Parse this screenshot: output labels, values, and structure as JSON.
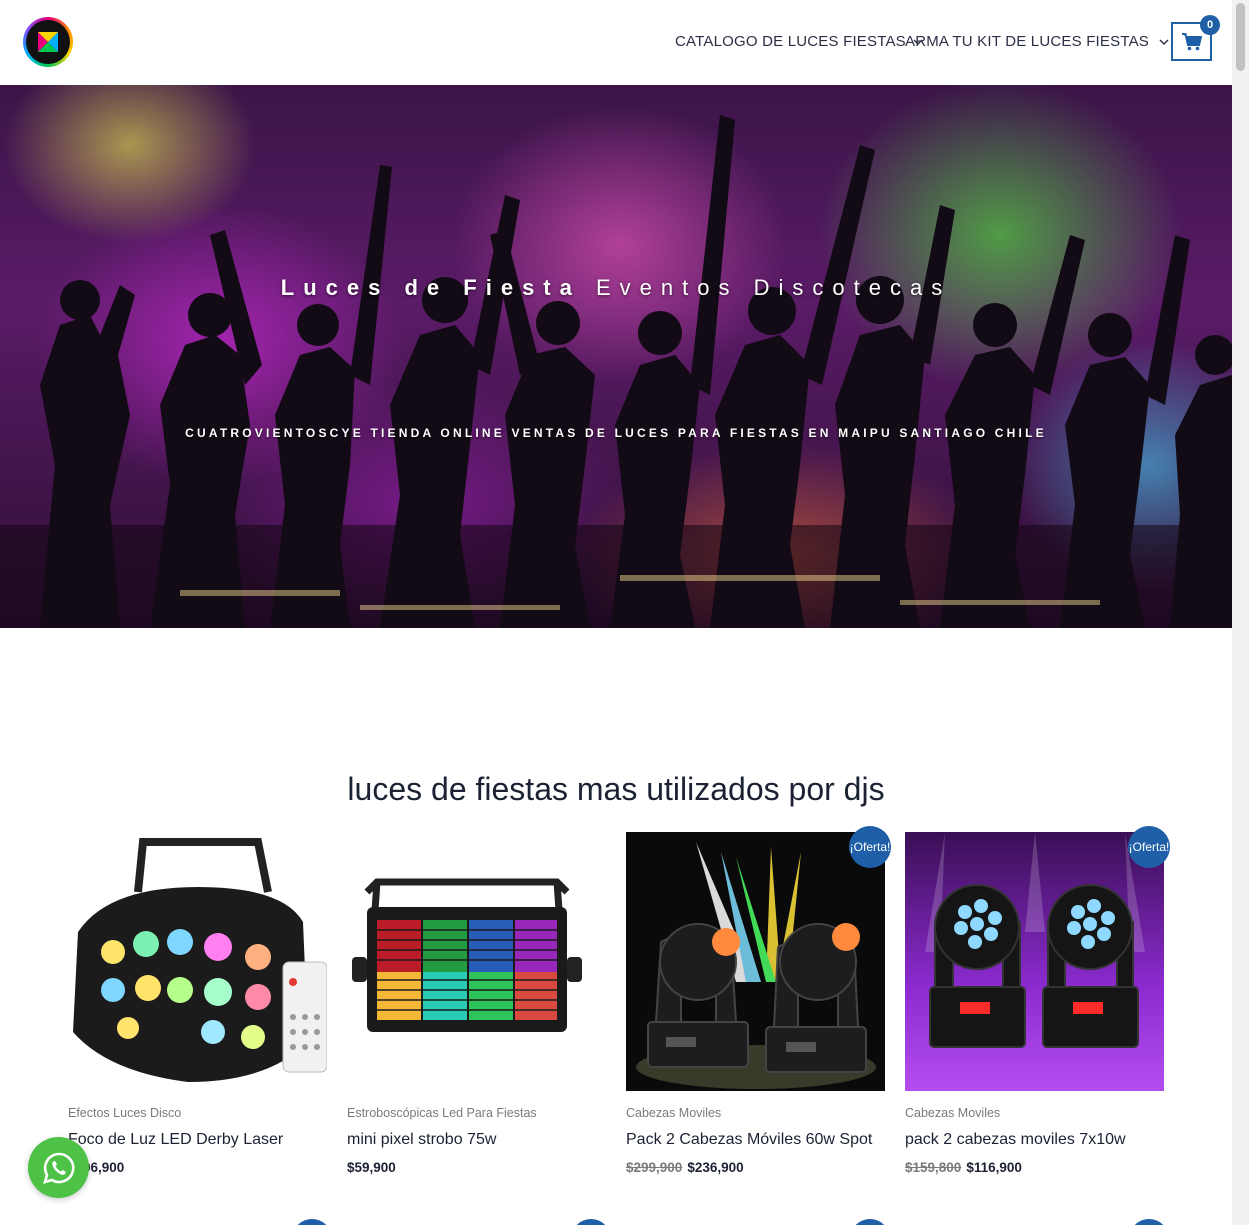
{
  "header": {
    "nav": [
      {
        "label": "CATALOGO DE LUCES FIESTAS"
      },
      {
        "label": "ARMA TU KIT DE LUCES FIESTAS"
      }
    ],
    "cart_count": "0"
  },
  "hero": {
    "title_bold": "Luces de Fiesta",
    "title_light": "Eventos Discotecas",
    "subtitle": "CUATROVIENTOSCYE TIENDA ONLINE VENTAS DE LUCES PARA FIESTAS EN MAIPU SANTIAGO CHILE"
  },
  "section": {
    "title": "luces de fiestas mas utilizados por djs"
  },
  "products": [
    {
      "category": "Efectos Luces Disco",
      "name": "Foco de Luz LED Derby Laser",
      "price": "$106,900",
      "old_price": ""
    },
    {
      "category": "Estroboscópicas Led Para Fiestas",
      "name": "mini pixel strobo 75w",
      "price": "$59,900",
      "old_price": ""
    },
    {
      "category": "Cabezas Moviles",
      "name": "Pack 2 Cabezas Móviles 60w Spot",
      "price": "$236,900",
      "old_price": "$299,900",
      "badge": "¡Oferta!"
    },
    {
      "category": "Cabezas Moviles",
      "name": "pack 2 cabezas moviles 7x10w",
      "price": "$116,900",
      "old_price": "$159,800",
      "badge": "¡Oferta!"
    }
  ],
  "icons": {
    "cart": "shopping-cart-icon",
    "chevron": "chevron-down-icon",
    "whatsapp": "whatsapp-icon"
  },
  "colors": {
    "accent": "#1e5fa8",
    "whatsapp": "#4dc247",
    "text_dark": "#1c2233"
  }
}
